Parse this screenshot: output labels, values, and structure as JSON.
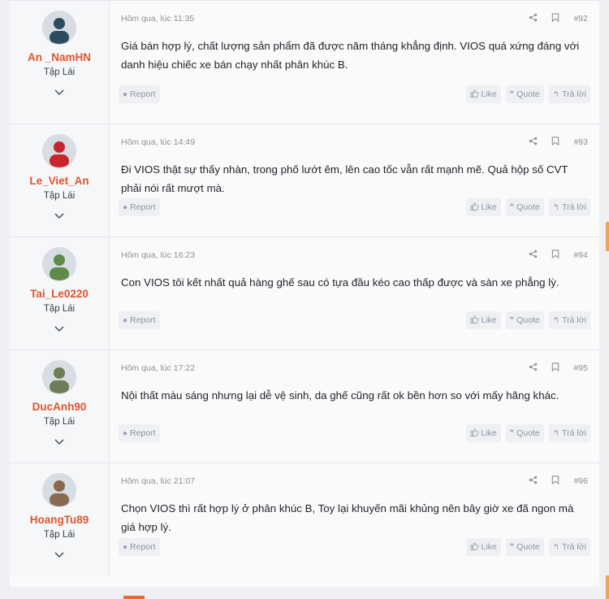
{
  "posts": [
    {
      "username": "An _NamHN",
      "user_title": "Tập Lái",
      "timestamp": "Hôm qua, lúc 11:35",
      "number": "#92",
      "body": "Giá bán hợp lý, chất lượng sản phẩm đã được năm tháng khẳng định. VIOS quá xứng đáng với danh hiệu chiếc xe bán chạy nhất phân khúc B.",
      "avatar_color": "#2b4b5e"
    },
    {
      "username": "Le_Viet_An",
      "user_title": "Tập Lái",
      "timestamp": "Hôm qua, lúc 14:49",
      "number": "#93",
      "body": "Đi VIOS thật sự thấy nhàn, trong phố lướt êm, lên cao tốc vẫn rất mạnh mẽ. Quả hộp số CVT phải nói rất mượt mà.",
      "avatar_color": "#c9252b"
    },
    {
      "username": "Tai_Le0220",
      "user_title": "Tập Lái",
      "timestamp": "Hôm qua, lúc 16:23",
      "number": "#94",
      "body": "Con VIOS tôi kết nhất quả hàng ghế sau có tựa đầu kéo cao thấp được và sàn xe phẳng lỳ.",
      "avatar_color": "#5f8a4a"
    },
    {
      "username": "DucAnh90",
      "user_title": "Tập Lái",
      "timestamp": "Hôm qua, lúc 17:22",
      "number": "#95",
      "body": "Nội thất màu sáng nhưng lại dễ vệ sinh, da ghế cũng rất ok bền hơn so với mấy hãng khác.",
      "avatar_color": "#6e7d55"
    },
    {
      "username": "HoangTu89",
      "user_title": "Tập Lái",
      "timestamp": "Hôm qua, lúc 21:07",
      "number": "#96",
      "body": "Chọn VIOS thì rất hợp lý ở phân khúc B, Toy lại khuyến mãi khủng nên bây giờ xe đã ngon mà giá hợp lý.",
      "avatar_color": "#8a6a4f"
    }
  ],
  "actions": {
    "report": "Report",
    "like": "Like",
    "quote": "Quote",
    "reply": "Trả lời"
  },
  "icons": {
    "share": "share-icon",
    "bookmark": "bookmark-icon",
    "expand": "chevron-down-icon"
  },
  "colors": {
    "username": "#e0562b",
    "accent": "#f0a35b"
  }
}
